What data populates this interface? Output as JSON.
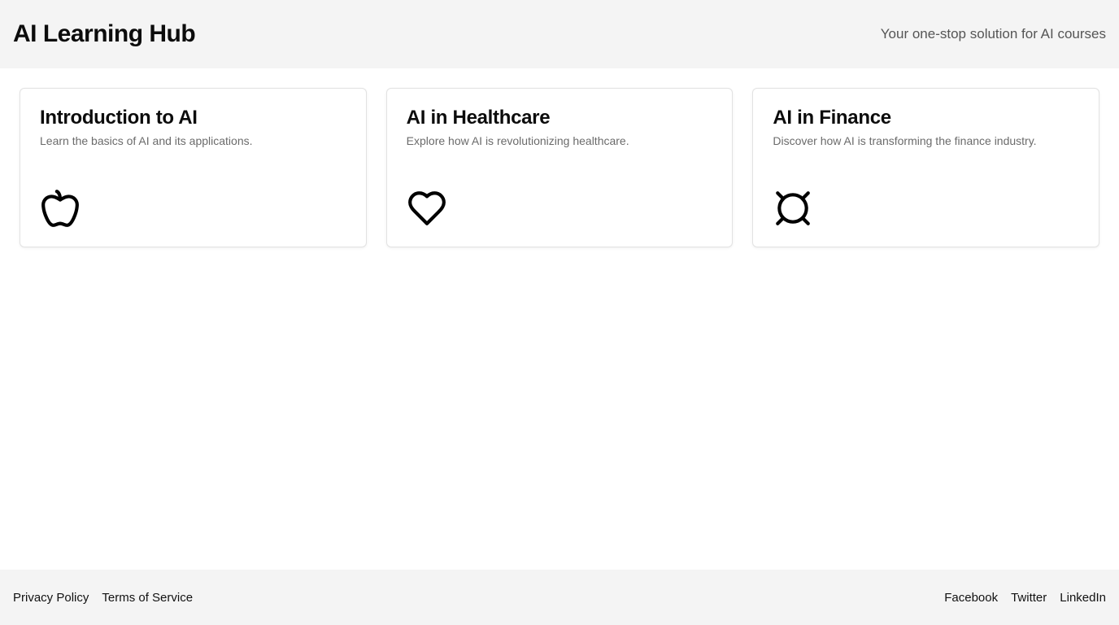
{
  "header": {
    "title": "AI Learning Hub",
    "tagline": "Your one-stop solution for AI courses"
  },
  "courses": [
    {
      "title": "Introduction to AI",
      "description": "Learn the basics of AI and its applications.",
      "icon": "apple-icon"
    },
    {
      "title": "AI in Healthcare",
      "description": "Explore how AI is revolutionizing healthcare.",
      "icon": "heart-icon"
    },
    {
      "title": "AI in Finance",
      "description": "Discover how AI is transforming the finance industry.",
      "icon": "currency-icon"
    }
  ],
  "footer": {
    "left_links": [
      "Privacy Policy",
      "Terms of Service"
    ],
    "right_links": [
      "Facebook",
      "Twitter",
      "LinkedIn"
    ]
  },
  "colors": {
    "header_bg": "#f4f4f4",
    "footer_bg": "#f4f4f4",
    "card_border": "#e2e2e2",
    "muted_text": "#6b6b6b"
  }
}
